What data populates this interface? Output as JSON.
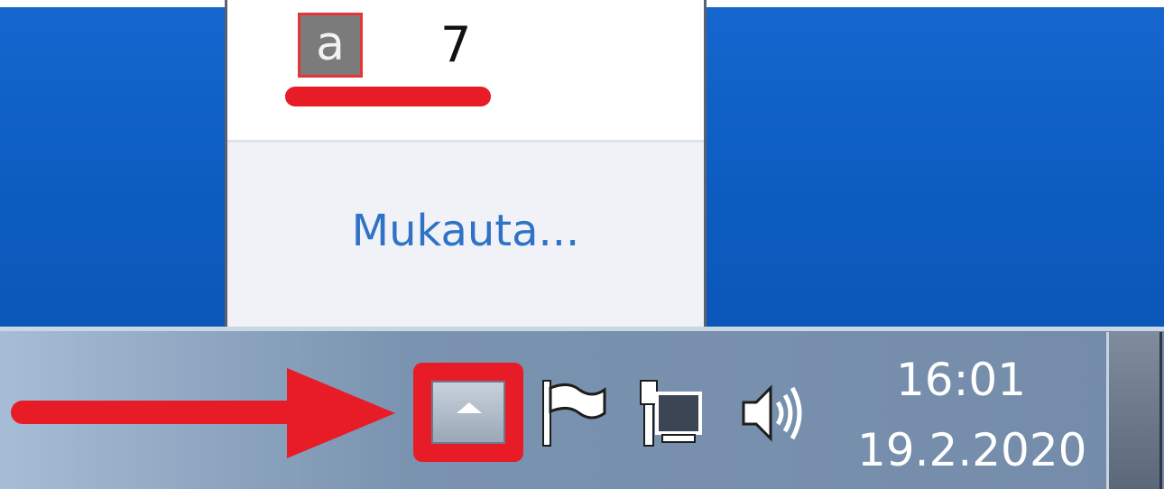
{
  "overflow_panel": {
    "app_icon_letter": "a",
    "app_count": "7",
    "customize_label": "Mukauta..."
  },
  "taskbar": {
    "show_hidden_icon": "chevron-up-icon",
    "tray_icons": [
      "action-center-flag-icon",
      "network-icon",
      "speaker-icon"
    ],
    "clock": {
      "time": "16:01",
      "date": "19.2.2020"
    }
  },
  "colors": {
    "desktop": "#0b5fc4",
    "highlight_red": "#e81c27",
    "link_blue": "#2f72c6"
  }
}
